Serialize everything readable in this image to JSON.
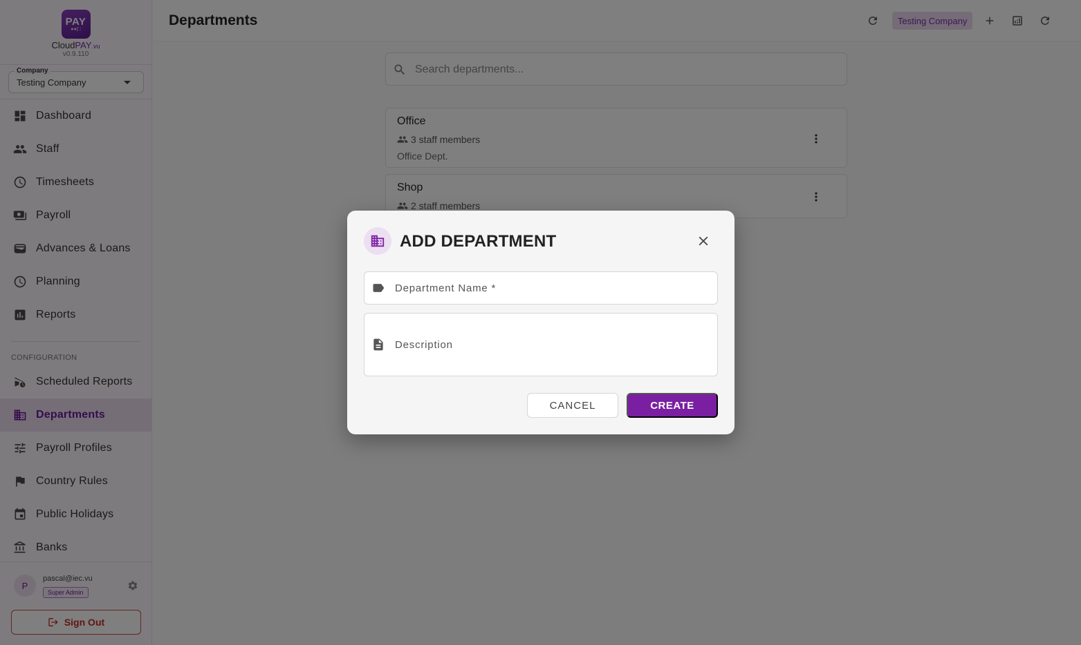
{
  "brand": {
    "logo_text": "PAY",
    "name_prefix": "Cloud",
    "name_highlight": "PAY",
    "name_suffix": ".vu",
    "version": "v0.9.110"
  },
  "company_selector": {
    "label": "Company",
    "value": "Testing Company"
  },
  "nav": {
    "main_items": [
      {
        "label": "Dashboard",
        "icon": "dashboard-icon"
      },
      {
        "label": "Staff",
        "icon": "people-icon"
      },
      {
        "label": "Timesheets",
        "icon": "clock-icon"
      },
      {
        "label": "Payroll",
        "icon": "payments-icon"
      },
      {
        "label": "Advances & Loans",
        "icon": "wallet-icon"
      },
      {
        "label": "Planning",
        "icon": "clock-icon"
      },
      {
        "label": "Reports",
        "icon": "bar-chart-icon"
      }
    ],
    "config_label": "CONFIGURATION",
    "config_items": [
      {
        "label": "Scheduled Reports",
        "icon": "schedule-send-icon"
      },
      {
        "label": "Departments",
        "icon": "domain-icon",
        "active": true
      },
      {
        "label": "Payroll Profiles",
        "icon": "tune-icon"
      },
      {
        "label": "Country Rules",
        "icon": "flag-icon"
      },
      {
        "label": "Public Holidays",
        "icon": "calendar-icon"
      },
      {
        "label": "Banks",
        "icon": "bank-icon"
      }
    ]
  },
  "user": {
    "initial": "P",
    "email": "pascal@iec.vu",
    "role": "Super Admin",
    "sign_out": "Sign Out"
  },
  "header": {
    "title": "Departments",
    "company_chip": "Testing Company"
  },
  "search": {
    "placeholder": "Search departments..."
  },
  "departments": [
    {
      "name": "Office",
      "staff_count": "3 staff members",
      "description": "Office Dept."
    },
    {
      "name": "Shop",
      "staff_count": "2 staff members",
      "description": ""
    }
  ],
  "dialog": {
    "title": "ADD DEPARTMENT",
    "name_label": "Department Name *",
    "description_label": "Description",
    "cancel": "CANCEL",
    "create": "CREATE"
  },
  "colors": {
    "accent": "#7b1fa2",
    "active_bg": "#eadcef",
    "danger": "#c62828"
  }
}
